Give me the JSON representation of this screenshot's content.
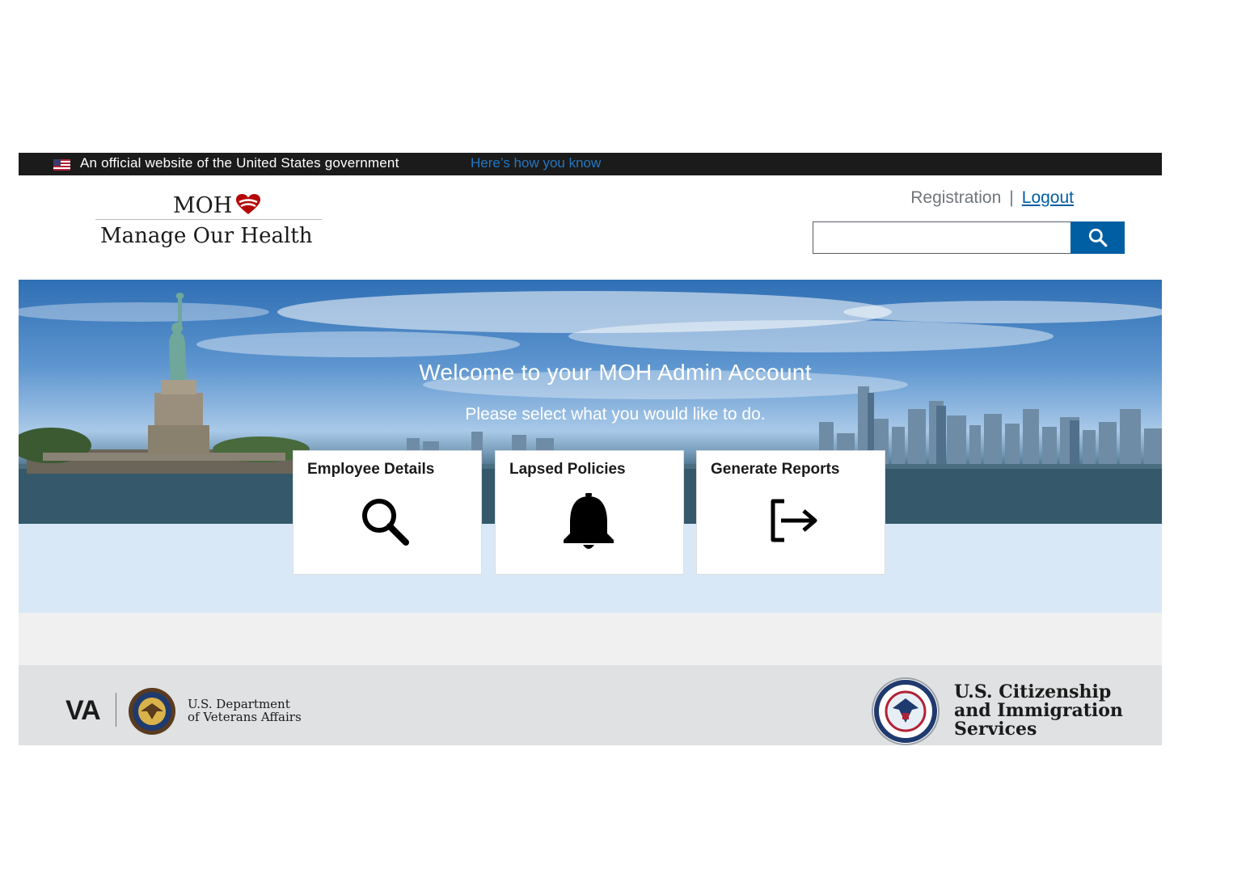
{
  "gov_banner": {
    "text": "An official website of the United States government",
    "link": "Here’s how you know"
  },
  "header": {
    "logo": {
      "abbr": "MOH",
      "name": "Manage Our Health"
    },
    "links": {
      "registration": "Registration",
      "separator": "|",
      "logout": "Logout"
    },
    "search": {
      "value": "",
      "placeholder": ""
    }
  },
  "hero": {
    "title": "Welcome to your MOH Admin Account",
    "subtitle": "Please select what you would like to do."
  },
  "cards": [
    {
      "label": "Employee Details",
      "icon": "search-icon"
    },
    {
      "label": "Lapsed Policies",
      "icon": "bell-icon"
    },
    {
      "label": "Generate Reports",
      "icon": "logout-arrow-icon"
    }
  ],
  "footer": {
    "va": {
      "mark": "VA",
      "dept_line1": "U.S. Department",
      "dept_line2": "of Veterans Affairs"
    },
    "uscis": {
      "line1": "U.S. Citizenship",
      "line2": "and Immigration",
      "line3": "Services"
    }
  },
  "colors": {
    "banner_bg": "#1b1b1b",
    "link_blue": "#2378c3",
    "primary": "#005ea2",
    "heart": "#b50909",
    "light_band": "#d9e8f6",
    "footer_bg": "#dfe1e2"
  }
}
